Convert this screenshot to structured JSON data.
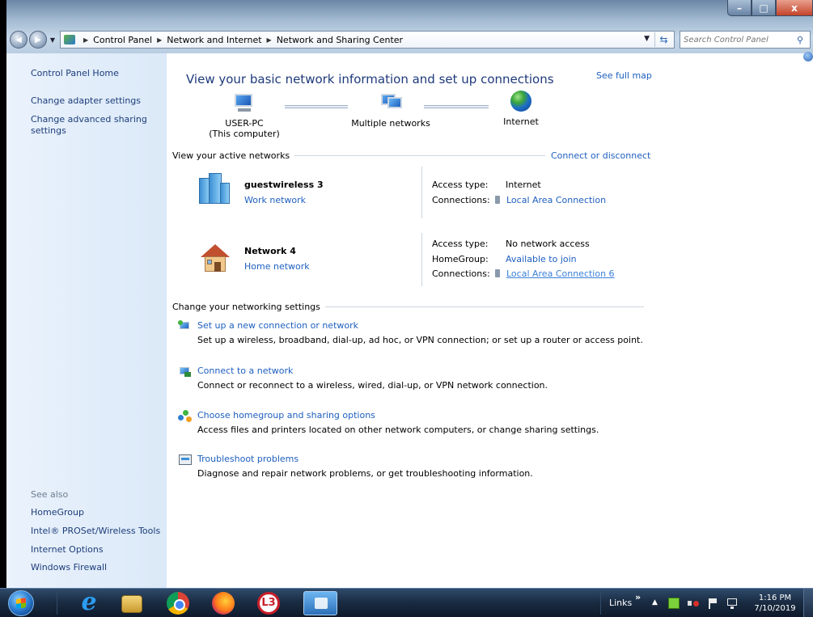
{
  "address": {
    "crumbs": [
      "Control Panel",
      "Network and Internet",
      "Network and Sharing Center"
    ],
    "search_placeholder": "Search Control Panel"
  },
  "window_controls": {
    "minimize": "–",
    "maximize": "□",
    "close": "x"
  },
  "sidebar": {
    "home": "Control Panel Home",
    "links": [
      "Change adapter settings",
      "Change advanced sharing settings"
    ],
    "see_also": "See also",
    "see_also_links": [
      "HomeGroup",
      "Intel® PROSet/Wireless Tools",
      "Internet Options",
      "Windows Firewall"
    ]
  },
  "main": {
    "title": "View your basic network information and set up connections",
    "see_full_map": "See full map",
    "map": {
      "computer_line1": "USER-PC",
      "computer_line2": "(This computer)",
      "middle": "Multiple networks",
      "internet": "Internet"
    },
    "active_header": "View your active networks",
    "connect_disconnect": "Connect or disconnect",
    "networks": [
      {
        "name": "guestwireless  3",
        "type": "Work network",
        "access_label": "Access type:",
        "access_value": "Internet",
        "connections_label": "Connections:",
        "connections_value": "Local Area Connection"
      },
      {
        "name": "Network  4",
        "type": "Home network",
        "access_label": "Access type:",
        "access_value": "No network access",
        "homegroup_label": "HomeGroup:",
        "homegroup_value": "Available to join",
        "connections_label": "Connections:",
        "connections_value": "Local Area Connection 6"
      }
    ],
    "settings_header": "Change your networking settings",
    "tasks": [
      {
        "link": "Set up a new connection or network",
        "desc": "Set up a wireless, broadband, dial-up, ad hoc, or VPN connection; or set up a router or access point."
      },
      {
        "link": "Connect to a network",
        "desc": "Connect or reconnect to a wireless, wired, dial-up, or VPN network connection."
      },
      {
        "link": "Choose homegroup and sharing options",
        "desc": "Access files and printers located on other network computers, or change sharing settings."
      },
      {
        "link": "Troubleshoot problems",
        "desc": "Diagnose and repair network problems, or get troubleshooting information."
      }
    ]
  },
  "taskbar": {
    "l3_label": "L3",
    "links_label": "Links",
    "chevron": "»",
    "tray_up": "▲",
    "time": "1:16 PM",
    "date": "7/10/2019"
  }
}
